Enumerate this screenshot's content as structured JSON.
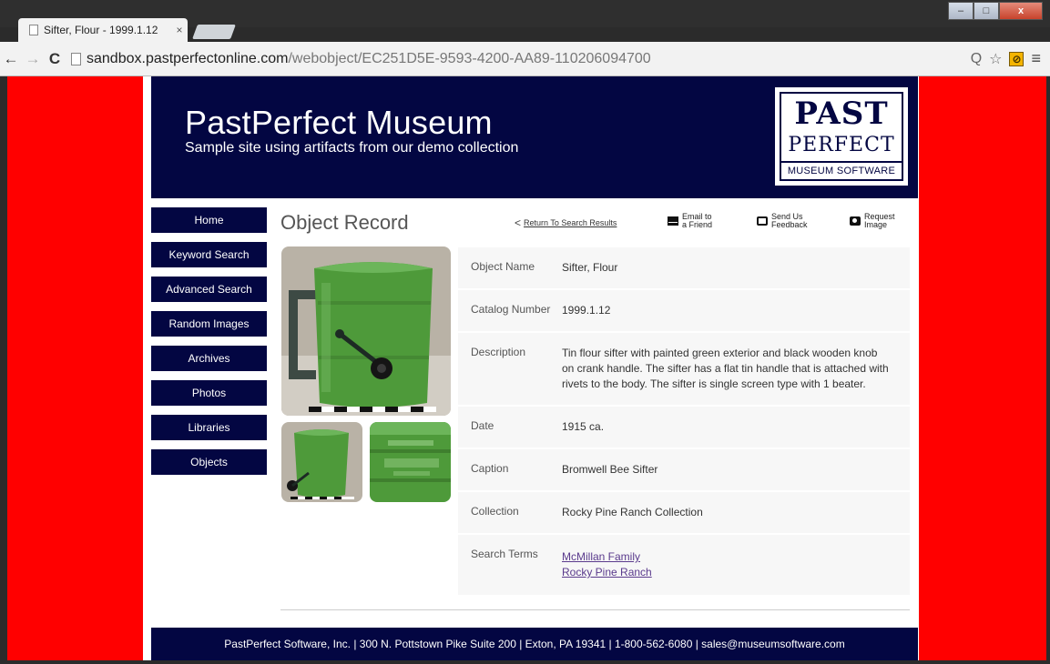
{
  "browser": {
    "tab_title": "Sifter, Flour - 1999.1.12",
    "tab_close": "×",
    "url_host": "sandbox.pastperfectonline.com",
    "url_path": "/webobject/EC251D5E-9593-4200-AA89-110206094700",
    "back_glyph": "←",
    "forward_glyph": "→",
    "reload_glyph": "C",
    "minimize_glyph": "‒",
    "maximize_glyph": "□",
    "close_glyph": "x",
    "zoom_glyph": "Q",
    "star_glyph": "☆",
    "ext_glyph": "⊘",
    "menu_glyph": "≡"
  },
  "header": {
    "title": "PastPerfect Museum",
    "subtitle": "Sample site using artifacts from our demo collection",
    "logo_past": "PAST",
    "logo_perfect": "PERFECT",
    "logo_museum": "MUSEUM SOFTWARE"
  },
  "nav": [
    "Home",
    "Keyword Search",
    "Advanced Search",
    "Random Images",
    "Archives",
    "Photos",
    "Libraries",
    "Objects"
  ],
  "record": {
    "title": "Object Record",
    "back_label": "Return To Search Results",
    "back_chevron": "<",
    "email_line1": "Email to",
    "email_line2": "a Friend",
    "feedback_line1": "Send Us",
    "feedback_line2": "Feedback",
    "request_line1": "Request",
    "request_line2": "Image"
  },
  "fields": [
    {
      "label": "Object Name",
      "value": "Sifter, Flour"
    },
    {
      "label": "Catalog Number",
      "value": "1999.1.12"
    },
    {
      "label": "Description",
      "value": "Tin flour sifter with painted green exterior and black wooden knob on crank handle. The sifter has a flat tin handle that is attached with rivets to the body. The sifter is single screen type with 1 beater."
    },
    {
      "label": "Date",
      "value": "1915 ca."
    },
    {
      "label": "Caption",
      "value": "Bromwell Bee Sifter"
    },
    {
      "label": "Collection",
      "value": "Rocky Pine Ranch Collection"
    }
  ],
  "search_terms": {
    "label": "Search Terms",
    "links": [
      "McMillan Family",
      "Rocky Pine Ranch"
    ]
  },
  "footer": "PastPerfect Software, Inc. | 300 N. Pottstown Pike Suite 200 | Exton, PA 19341 | 1-800-562-6080 | sales@museumsoftware.com",
  "colors": {
    "navy": "#030642",
    "background_red": "#ff0000",
    "sifter_green": "#4e9a3a"
  }
}
